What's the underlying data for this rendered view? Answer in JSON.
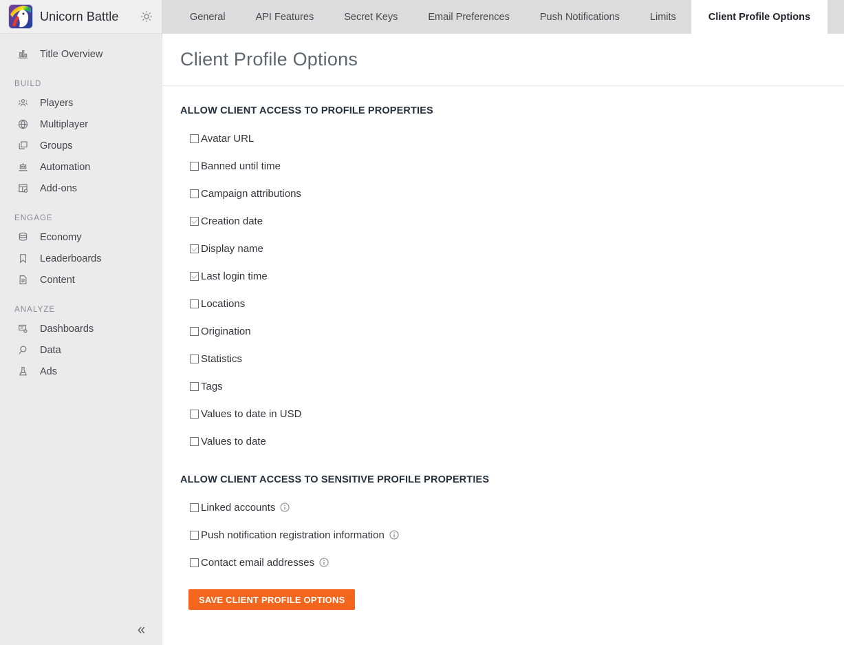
{
  "sidebar": {
    "brand": {
      "title": "Unicorn Battle",
      "logo_icon": "unicorn-logo",
      "gear_icon": "gear-icon"
    },
    "top_items": [
      {
        "label": "Title Overview",
        "icon": "chart-bars-icon"
      }
    ],
    "groups": [
      {
        "label": "BUILD",
        "items": [
          {
            "label": "Players",
            "icon": "players-icon"
          },
          {
            "label": "Multiplayer",
            "icon": "globe-icon"
          },
          {
            "label": "Groups",
            "icon": "layers-icon"
          },
          {
            "label": "Automation",
            "icon": "robot-icon"
          },
          {
            "label": "Add-ons",
            "icon": "addons-icon"
          }
        ]
      },
      {
        "label": "ENGAGE",
        "items": [
          {
            "label": "Economy",
            "icon": "coins-icon"
          },
          {
            "label": "Leaderboards",
            "icon": "bookmark-icon"
          },
          {
            "label": "Content",
            "icon": "document-icon"
          }
        ]
      },
      {
        "label": "ANALYZE",
        "items": [
          {
            "label": "Dashboards",
            "icon": "dashboard-icon"
          },
          {
            "label": "Data",
            "icon": "data-icon"
          },
          {
            "label": "Ads",
            "icon": "flask-icon"
          }
        ]
      }
    ],
    "collapse_icon": "chevron-double-left-icon"
  },
  "tabs": [
    {
      "label": "General",
      "active": false
    },
    {
      "label": "API Features",
      "active": false
    },
    {
      "label": "Secret Keys",
      "active": false
    },
    {
      "label": "Email Preferences",
      "active": false
    },
    {
      "label": "Push Notifications",
      "active": false
    },
    {
      "label": "Limits",
      "active": false
    },
    {
      "label": "Client Profile Options",
      "active": true
    }
  ],
  "page": {
    "title": "Client Profile Options"
  },
  "sections": [
    {
      "heading": "ALLOW CLIENT ACCESS TO PROFILE PROPERTIES",
      "options": [
        {
          "label": "Avatar URL",
          "checked": false,
          "info": false
        },
        {
          "label": "Banned until time",
          "checked": false,
          "info": false
        },
        {
          "label": "Campaign attributions",
          "checked": false,
          "info": false
        },
        {
          "label": "Creation date",
          "checked": true,
          "info": false
        },
        {
          "label": "Display name",
          "checked": true,
          "info": false
        },
        {
          "label": "Last login time",
          "checked": true,
          "info": false
        },
        {
          "label": "Locations",
          "checked": false,
          "info": false
        },
        {
          "label": "Origination",
          "checked": false,
          "info": false
        },
        {
          "label": "Statistics",
          "checked": false,
          "info": false
        },
        {
          "label": "Tags",
          "checked": false,
          "info": false
        },
        {
          "label": "Values to date in USD",
          "checked": false,
          "info": false
        },
        {
          "label": "Values to date",
          "checked": false,
          "info": false
        }
      ]
    },
    {
      "heading": "ALLOW CLIENT ACCESS TO SENSITIVE PROFILE PROPERTIES",
      "options": [
        {
          "label": "Linked accounts",
          "checked": false,
          "info": true
        },
        {
          "label": "Push notification registration information",
          "checked": false,
          "info": true
        },
        {
          "label": "Contact email addresses",
          "checked": false,
          "info": true
        }
      ]
    }
  ],
  "save_button": {
    "label": "SAVE CLIENT PROFILE OPTIONS"
  },
  "colors": {
    "accent_orange": "#f4661e",
    "sidebar_bg": "#ebebeb",
    "tabbar_bg": "#dcdcdc",
    "active_tab_bg": "#ffffff",
    "title_gray": "#5d6770"
  }
}
